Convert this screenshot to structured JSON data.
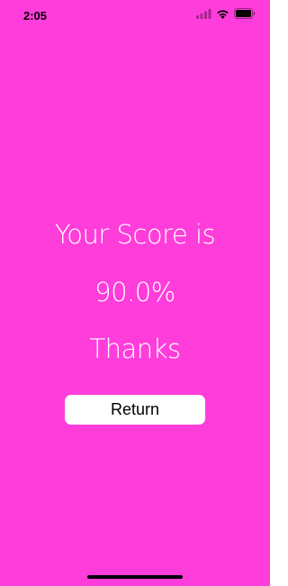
{
  "status_bar": {
    "time": "2:05",
    "icons": [
      "signal-icon",
      "wifi-icon",
      "battery-icon"
    ]
  },
  "main": {
    "score_title": "Your Score is",
    "score_value": "90.0%",
    "thanks_text": "Thanks",
    "return_label": "Return"
  },
  "colors": {
    "background": "#ff3ddb",
    "text": "#ffffff",
    "button_bg": "#ffffff",
    "button_text": "#000000"
  }
}
